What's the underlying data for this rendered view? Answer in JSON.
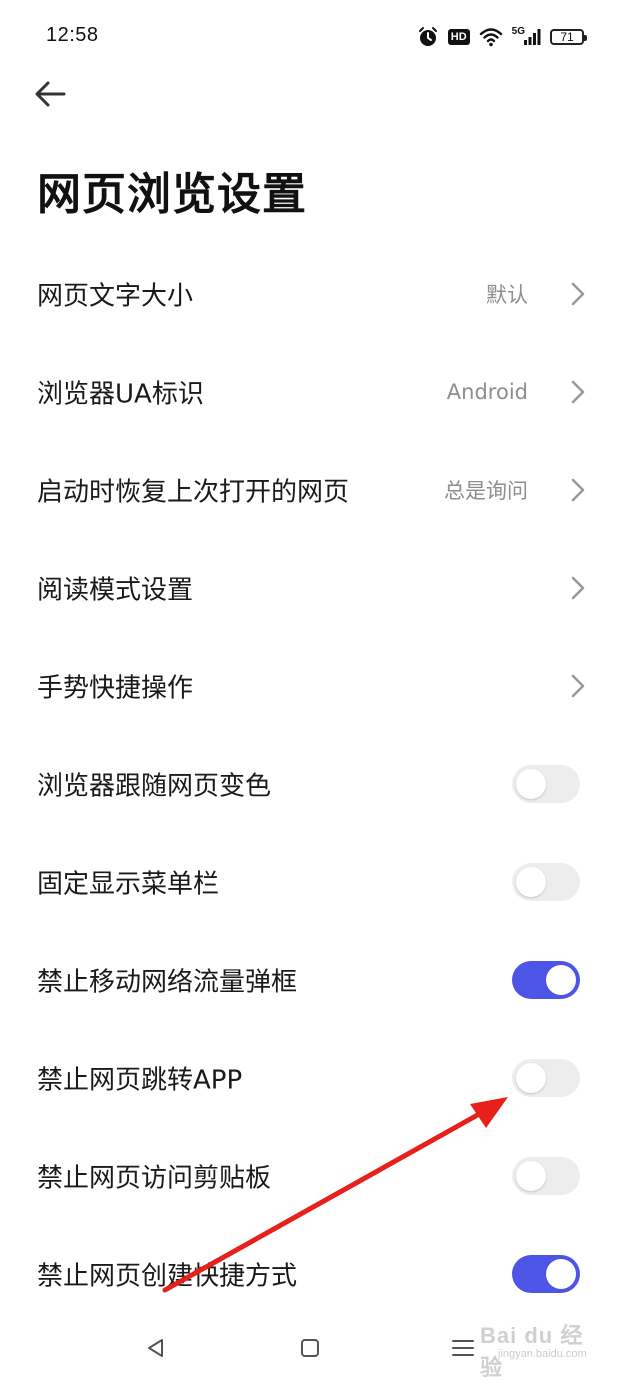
{
  "status_bar": {
    "time": "12:58",
    "hd": "HD",
    "network": "5G",
    "battery": "71"
  },
  "page": {
    "title": "网页浏览设置"
  },
  "settings": {
    "font_size": {
      "label": "网页文字大小",
      "value": "默认"
    },
    "ua": {
      "label": "浏览器UA标识",
      "value": "Android"
    },
    "restore": {
      "label": "启动时恢复上次打开的网页",
      "value": "总是询问"
    },
    "reader": {
      "label": "阅读模式设置"
    },
    "gestures": {
      "label": "手势快捷操作"
    },
    "follow_color": {
      "label": "浏览器跟随网页变色",
      "enabled": false
    },
    "fixed_menu": {
      "label": "固定显示菜单栏",
      "enabled": false
    },
    "block_data_popup": {
      "label": "禁止移动网络流量弹框",
      "enabled": true
    },
    "block_app_jump": {
      "label": "禁止网页跳转APP",
      "enabled": false
    },
    "block_clipboard": {
      "label": "禁止网页访问剪贴板",
      "enabled": false
    },
    "block_shortcut": {
      "label": "禁止网页创建快捷方式",
      "enabled": true
    }
  },
  "colors": {
    "toggle_on": "#4d55e6",
    "toggle_off": "#ededed",
    "annotation_arrow": "#e8201c"
  },
  "watermark": {
    "main": "Bai du 经验",
    "sub": "jingyan.baidu.com"
  }
}
